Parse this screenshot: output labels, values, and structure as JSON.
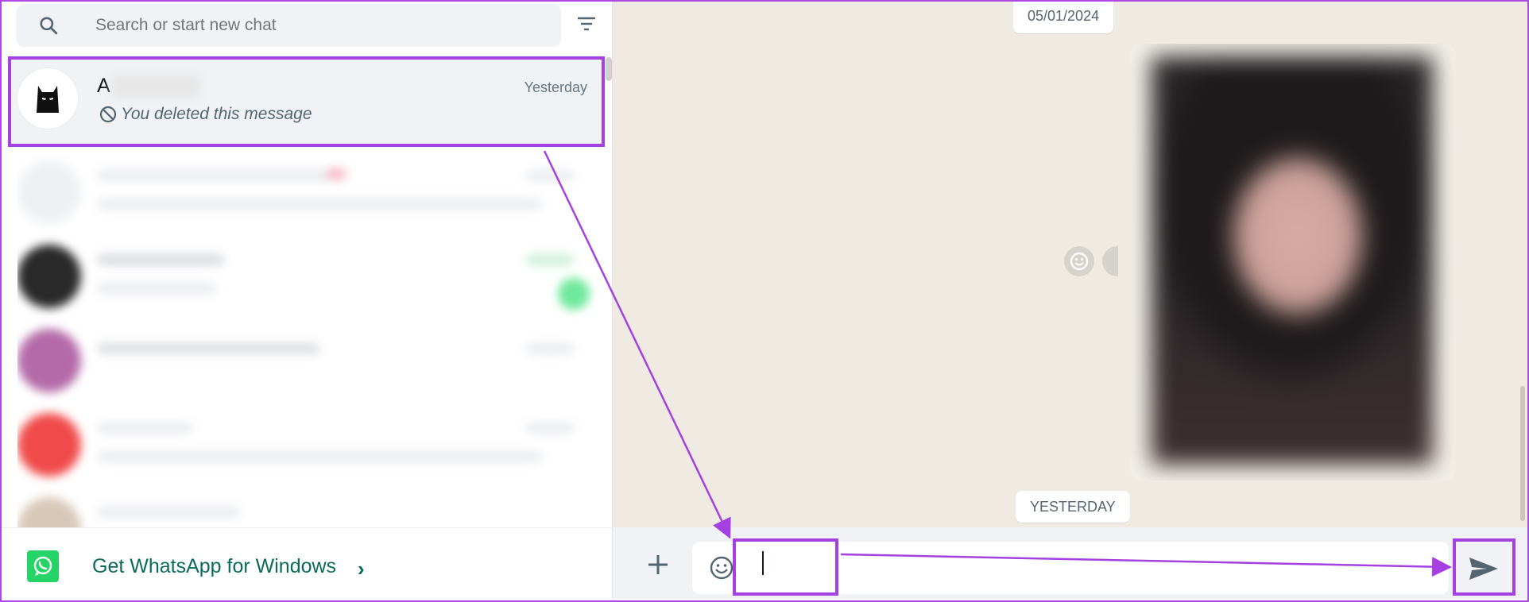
{
  "sidebar": {
    "search": {
      "placeholder": "Search or start new chat"
    },
    "active_chat": {
      "name": "A",
      "time": "Yesterday",
      "preview": "You deleted this message"
    },
    "get_app": {
      "label": "Get WhatsApp for Windows"
    }
  },
  "conversation": {
    "date_chips": [
      "05/01/2024",
      "YESTERDAY"
    ],
    "composer": {
      "placeholder": ""
    }
  },
  "colors": {
    "annotation": "#a441e0",
    "accent": "#25d366",
    "link": "#0b6b5a"
  }
}
